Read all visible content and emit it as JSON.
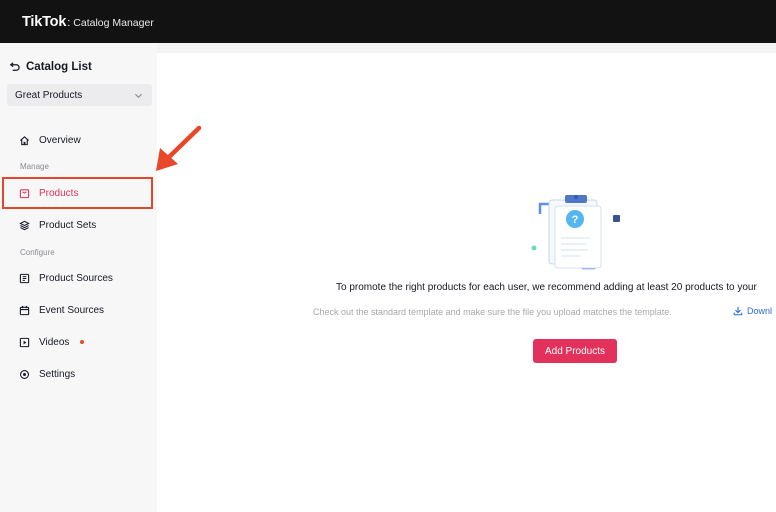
{
  "header": {
    "logo": "TikTok",
    "separator": ":",
    "product_name": "Catalog Manager"
  },
  "sidebar": {
    "back_icon": "back-arrow-icon",
    "title": "Catalog List",
    "catalog_select": {
      "value": "Great Products",
      "icon": "chevron-down-icon"
    },
    "items": [
      {
        "label": "Overview",
        "icon": "home-icon"
      },
      {
        "label": "Products",
        "icon": "bag-icon",
        "active": true
      },
      {
        "label": "Product Sets",
        "icon": "layers-icon"
      },
      {
        "label": "Product Sources",
        "icon": "source-icon"
      },
      {
        "label": "Event Sources",
        "icon": "calendar-icon"
      },
      {
        "label": "Videos",
        "icon": "video-icon",
        "badge": "dot"
      },
      {
        "label": "Settings",
        "icon": "settings-icon"
      }
    ],
    "sections": [
      "Manage",
      "Configure"
    ]
  },
  "main": {
    "empty_icon": "clipboard-question-icon",
    "message": "To promote the right products for each user, we recommend adding at least 20 products to your",
    "tip": "Check out the standard template and make sure the file you upload matches the template.",
    "download_label": "Downl",
    "download_icon": "download-icon",
    "add_button": "Add Products"
  },
  "colors": {
    "accent": "#e2315a",
    "topbar": "#121212",
    "annotation": "#e2472c",
    "link": "#2b6bd6"
  }
}
